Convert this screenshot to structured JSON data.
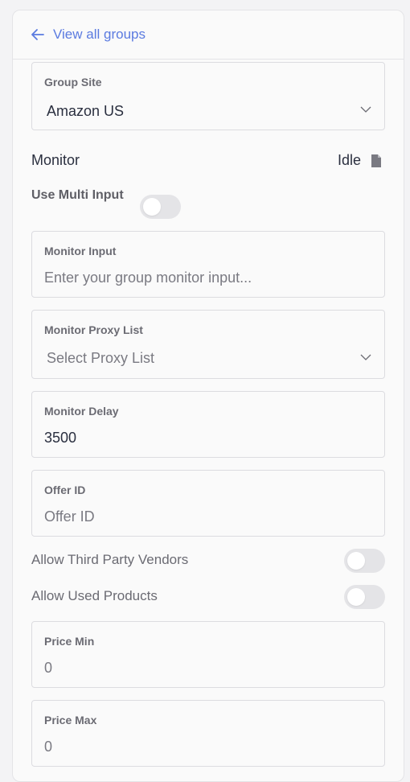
{
  "header": {
    "back_label": "View all groups"
  },
  "group_site": {
    "label": "Group Site",
    "value": "Amazon US"
  },
  "monitor": {
    "title": "Monitor",
    "status": "Idle"
  },
  "multi_input": {
    "label": "Use Multi Input",
    "enabled": false
  },
  "monitor_input": {
    "label": "Monitor Input",
    "placeholder": "Enter your group monitor input..."
  },
  "proxy_list": {
    "label": "Monitor Proxy List",
    "value": "Select Proxy List"
  },
  "monitor_delay": {
    "label": "Monitor Delay",
    "value": "3500"
  },
  "offer_id": {
    "label": "Offer ID",
    "placeholder": "Offer ID"
  },
  "third_party": {
    "label": "Allow Third Party Vendors",
    "enabled": false
  },
  "used_products": {
    "label": "Allow Used Products",
    "enabled": false
  },
  "price_min": {
    "label": "Price Min",
    "value": "0"
  },
  "price_max": {
    "label": "Price Max",
    "value": "0"
  },
  "colors": {
    "accent": "#5b7be0",
    "text": "#2a2f3f",
    "muted": "#6b6b73",
    "border": "#dcdce0"
  }
}
